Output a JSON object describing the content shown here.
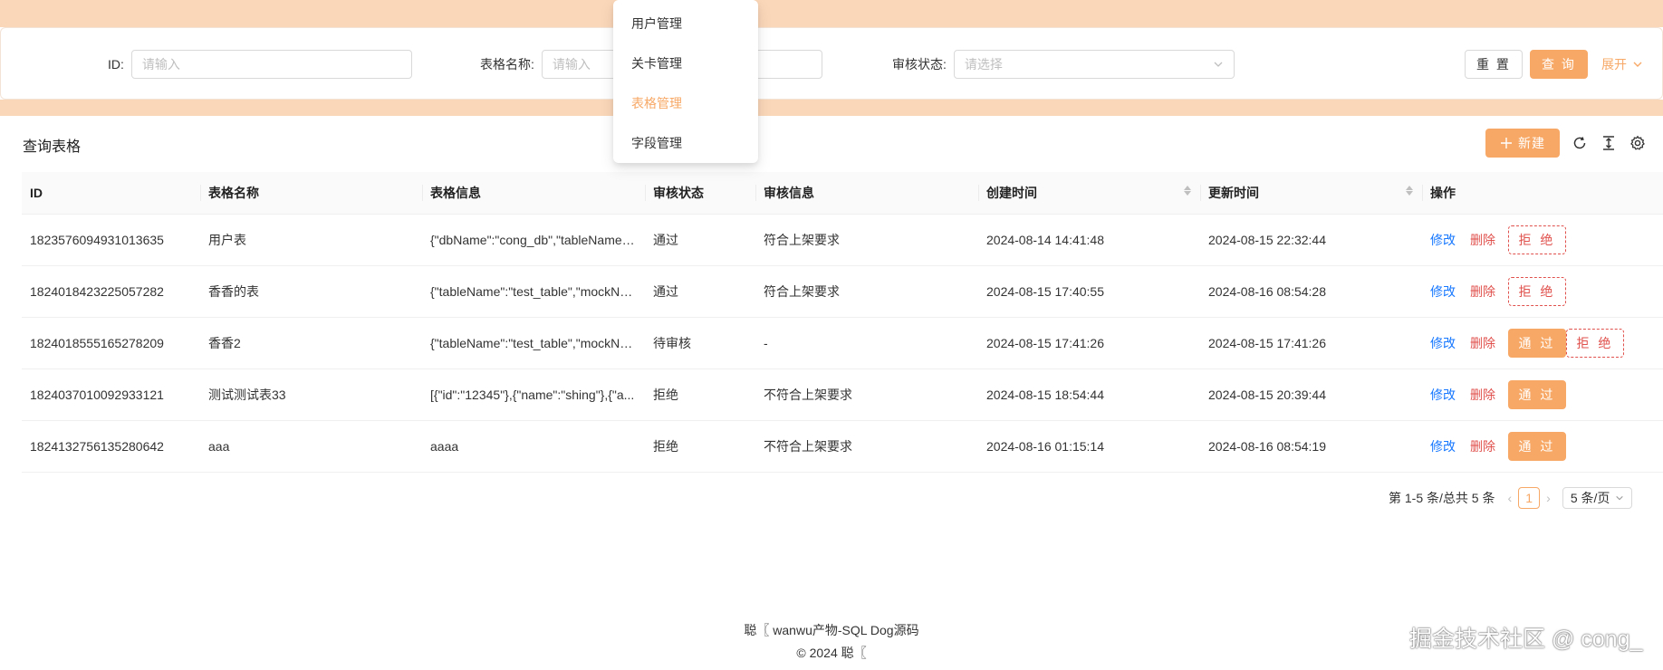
{
  "search": {
    "id_label": "ID:",
    "id_placeholder": "请输入",
    "table_name_label": "表格名称:",
    "table_name_placeholder": "请输入",
    "status_label": "审核状态:",
    "status_placeholder": "请选择",
    "reset_label": "重 置",
    "query_label": "查 询",
    "expand_label": "展开"
  },
  "dropdown": {
    "items": [
      {
        "label": "用户管理",
        "active": false
      },
      {
        "label": "关卡管理",
        "active": false
      },
      {
        "label": "表格管理",
        "active": true
      },
      {
        "label": "字段管理",
        "active": false
      }
    ]
  },
  "table_card": {
    "title": "查询表格",
    "new_label": "新建",
    "columns": [
      "ID",
      "表格名称",
      "表格信息",
      "审核状态",
      "审核信息",
      "创建时间",
      "更新时间",
      "操作"
    ],
    "rows": [
      {
        "id": "1823576094931013635",
        "name": "用户表",
        "info": "{\"dbName\":\"cong_db\",\"tableName\"...",
        "status": "通过",
        "review": "符合上架要求",
        "created": "2024-08-14 14:41:48",
        "updated": "2024-08-15 22:32:44",
        "edit": "修改",
        "delete": "删除",
        "pass": "",
        "reject": "拒 绝"
      },
      {
        "id": "1824018423225057282",
        "name": "香香的表",
        "info": "{\"tableName\":\"test_table\",\"mockNu...",
        "status": "通过",
        "review": "符合上架要求",
        "created": "2024-08-15 17:40:55",
        "updated": "2024-08-16 08:54:28",
        "edit": "修改",
        "delete": "删除",
        "pass": "",
        "reject": "拒 绝"
      },
      {
        "id": "1824018555165278209",
        "name": "香香2",
        "info": "{\"tableName\":\"test_table\",\"mockNu...",
        "status": "待审核",
        "review": "-",
        "created": "2024-08-15 17:41:26",
        "updated": "2024-08-15 17:41:26",
        "edit": "修改",
        "delete": "删除",
        "pass": "通 过",
        "reject": "拒 绝"
      },
      {
        "id": "1824037010092933121",
        "name": "测试测试表33",
        "info": "[{\"id\":\"12345\"},{\"name\":\"shing\"},{\"a...",
        "status": "拒绝",
        "review": "不符合上架要求",
        "created": "2024-08-15 18:54:44",
        "updated": "2024-08-15 20:39:44",
        "edit": "修改",
        "delete": "删除",
        "pass": "通 过",
        "reject": ""
      },
      {
        "id": "1824132756135280642",
        "name": "aaa",
        "info": "aaaa",
        "status": "拒绝",
        "review": "不符合上架要求",
        "created": "2024-08-16 01:15:14",
        "updated": "2024-08-16 08:54:19",
        "edit": "修改",
        "delete": "删除",
        "pass": "通 过",
        "reject": ""
      }
    ]
  },
  "pagination": {
    "summary": "第 1-5 条/总共 5 条",
    "current": "1",
    "page_size": "5 条/页"
  },
  "footer": {
    "line1": "聪〖 wanwu产物-SQL Dog源码",
    "line2": "© 2024 聪〖"
  },
  "watermark": "掘金技术社区 @ cong_",
  "colors": {
    "accent": "#f7a866",
    "band": "#fbd7b9",
    "link": "#1677ff",
    "danger": "#e0504c"
  }
}
